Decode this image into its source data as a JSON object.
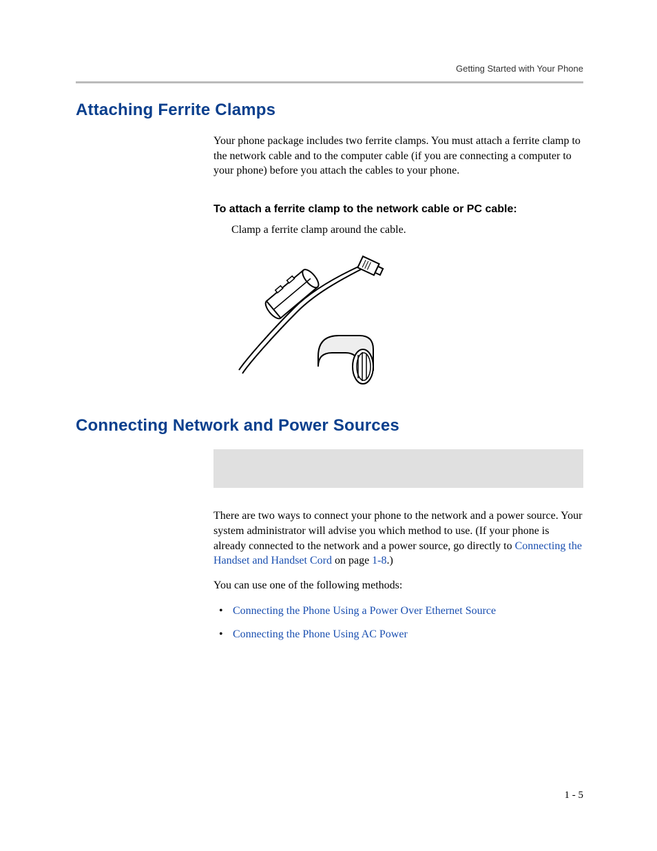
{
  "running_head": "Getting Started with Your Phone",
  "sections": {
    "ferrite": {
      "title": "Attaching Ferrite Clamps",
      "intro": "Your phone package includes two ferrite clamps. You must attach a ferrite clamp to the network cable and to the computer cable (if you are connecting a computer to your phone) before you attach the cables to your phone.",
      "subhead": "To attach a ferrite clamp to the network cable or PC cable:",
      "step": "Clamp a ferrite clamp around the cable."
    },
    "network": {
      "title": "Connecting Network and Power Sources",
      "para1_a": "There are two ways to connect your phone to the network and a power source. Your system administrator will advise you which method to use. (If your phone is already connected to the network and a power source, go directly to ",
      "link1": "Connecting the Handset and Handset Cord",
      "para1_b": " on page ",
      "pageref": "1-8",
      "para1_c": ".)",
      "para2": "You can use one of the following methods:",
      "bullets": [
        "Connecting the Phone Using a Power Over Ethernet Source",
        "Connecting the Phone Using AC Power"
      ]
    }
  },
  "page_number": "1 - 5"
}
